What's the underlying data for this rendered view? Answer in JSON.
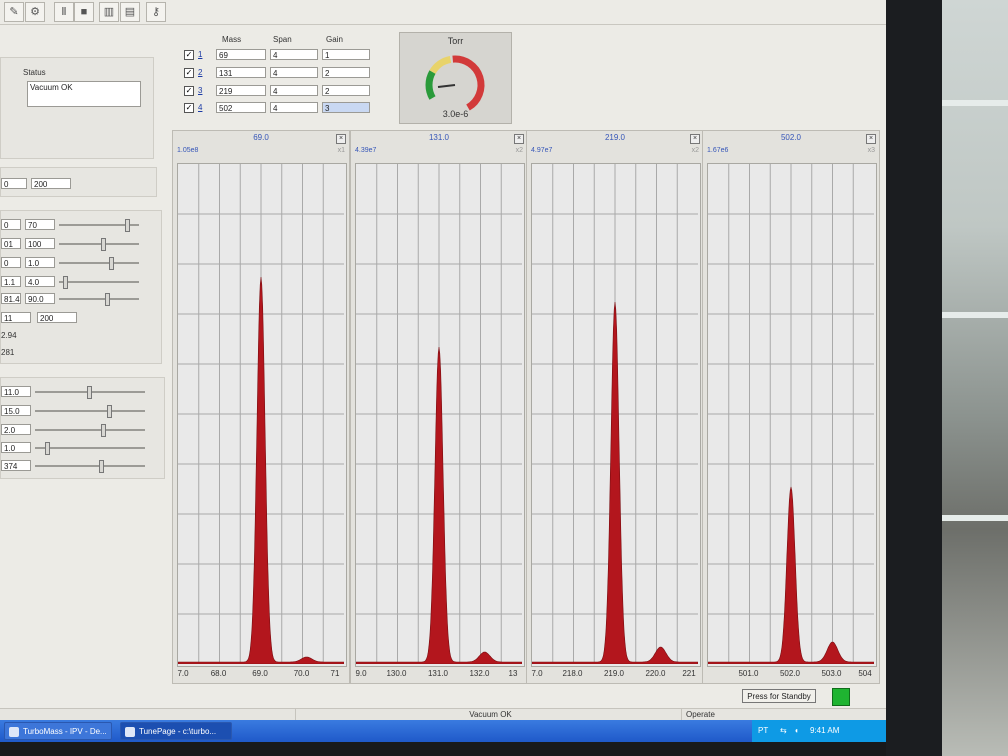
{
  "toolbar": {
    "icons": [
      "pen-icon",
      "tools-icon",
      "pause-icon",
      "stop-icon",
      "spectrum-icon",
      "chart-icon",
      "key-icon"
    ]
  },
  "status_panel": {
    "label": "Status",
    "value": "Vacuum OK"
  },
  "left_rows": {
    "row_a": [
      "0",
      "200"
    ],
    "group1": [
      [
        "0",
        "70"
      ],
      [
        "01",
        "100"
      ],
      [
        "0",
        "1.0"
      ],
      [
        "1.1",
        "4.0"
      ],
      [
        "81.4",
        "90.0"
      ],
      [
        "11",
        "200"
      ]
    ],
    "extras": [
      "2.94",
      "281"
    ],
    "group2": [
      "11.0",
      "15.0",
      "2.0",
      "1.0",
      "374"
    ],
    "group1_slider": [
      0.85,
      0.55,
      0.65,
      0.05,
      0.6
    ],
    "group2_slider": [
      0.5,
      0.65,
      0.6,
      0.1,
      0.6
    ]
  },
  "channels": {
    "headers": {
      "mass": "Mass",
      "span": "Span",
      "gain": "Gain"
    },
    "rows": [
      {
        "index": "1",
        "mass": "69",
        "span": "4",
        "gain": "1"
      },
      {
        "index": "2",
        "mass": "131",
        "span": "4",
        "gain": "2"
      },
      {
        "index": "3",
        "mass": "219",
        "span": "4",
        "gain": "2"
      },
      {
        "index": "4",
        "mass": "502",
        "span": "4",
        "gain": "3"
      }
    ]
  },
  "gauge": {
    "title": "Torr",
    "value": "3.0e-6",
    "colors": {
      "green": "#2a9a3a",
      "yellow": "#e8d36a",
      "red": "#d23a3a"
    }
  },
  "chart_data": [
    {
      "type": "area",
      "title": "69.0",
      "scale": "1.05e8",
      "zoom": "x1",
      "xlim": [
        67.0,
        71.0
      ],
      "xticks": [
        "7.0",
        "68.0",
        "69.0",
        "70.0",
        "71"
      ],
      "peak_x": 69.0,
      "peak_rel": 0.77,
      "iso_x": 70.1,
      "iso_rel": 0.01
    },
    {
      "type": "area",
      "title": "131.0",
      "scale": "4.39e7",
      "zoom": "x2",
      "xlim": [
        129.0,
        133.0
      ],
      "xticks": [
        "9.0",
        "130.0",
        "131.0",
        "132.0",
        "13"
      ],
      "peak_x": 131.0,
      "peak_rel": 0.63,
      "iso_x": 132.1,
      "iso_rel": 0.02
    },
    {
      "type": "area",
      "title": "219.0",
      "scale": "4.97e7",
      "zoom": "x2",
      "xlim": [
        217.0,
        221.0
      ],
      "xticks": [
        "7.0",
        "218.0",
        "219.0",
        "220.0",
        "221"
      ],
      "peak_x": 219.0,
      "peak_rel": 0.72,
      "iso_x": 220.1,
      "iso_rel": 0.03
    },
    {
      "type": "area",
      "title": "502.0",
      "scale": "1.67e6",
      "zoom": "x3",
      "xlim": [
        500.0,
        504.0
      ],
      "xticks": [
        "",
        "501.0",
        "502.0",
        "503.0",
        "504"
      ],
      "peak_x": 502.0,
      "peak_rel": 0.35,
      "iso_x": 503.0,
      "iso_rel": 0.04
    }
  ],
  "plot_color": "#b3161d",
  "standby_button": "Press for Standby",
  "statusbar": {
    "middle": "Vacuum OK",
    "right": "Operate"
  },
  "taskbar": {
    "tasks": [
      "TurboMass - IPV - De...",
      "TunePage - c:\\turbo..."
    ],
    "lang": "PT",
    "time": "9:41 AM"
  }
}
